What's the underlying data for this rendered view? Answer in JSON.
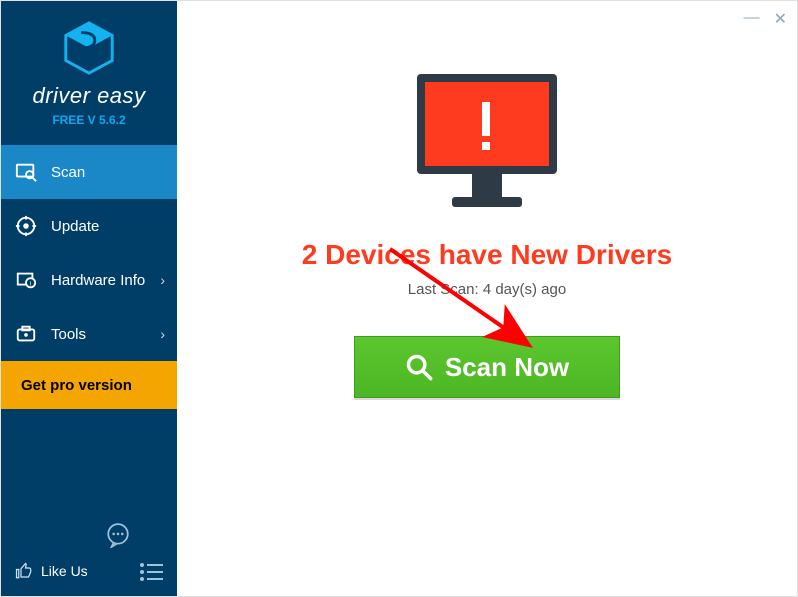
{
  "brand": {
    "name": "driver easy",
    "version": "FREE V 5.6.2"
  },
  "sidebar": {
    "items": [
      {
        "label": "Scan",
        "icon": "scan-icon",
        "active": true,
        "expand": false
      },
      {
        "label": "Update",
        "icon": "update-icon",
        "active": false,
        "expand": false
      },
      {
        "label": "Hardware Info",
        "icon": "hardware-icon",
        "active": false,
        "expand": true
      },
      {
        "label": "Tools",
        "icon": "tools-icon",
        "active": false,
        "expand": true
      }
    ],
    "pro_label": "Get pro version",
    "like_label": "Like Us"
  },
  "main": {
    "headline": "2 Devices have New Drivers",
    "last_scan": "Last Scan: 4 day(s) ago",
    "scan_button": "Scan Now"
  },
  "colors": {
    "sidebar_bg": "#003e68",
    "active_bg": "#1a87c7",
    "pro_bg": "#f5a500",
    "headline": "#ff3b1f",
    "scan_btn": "#4db625"
  }
}
